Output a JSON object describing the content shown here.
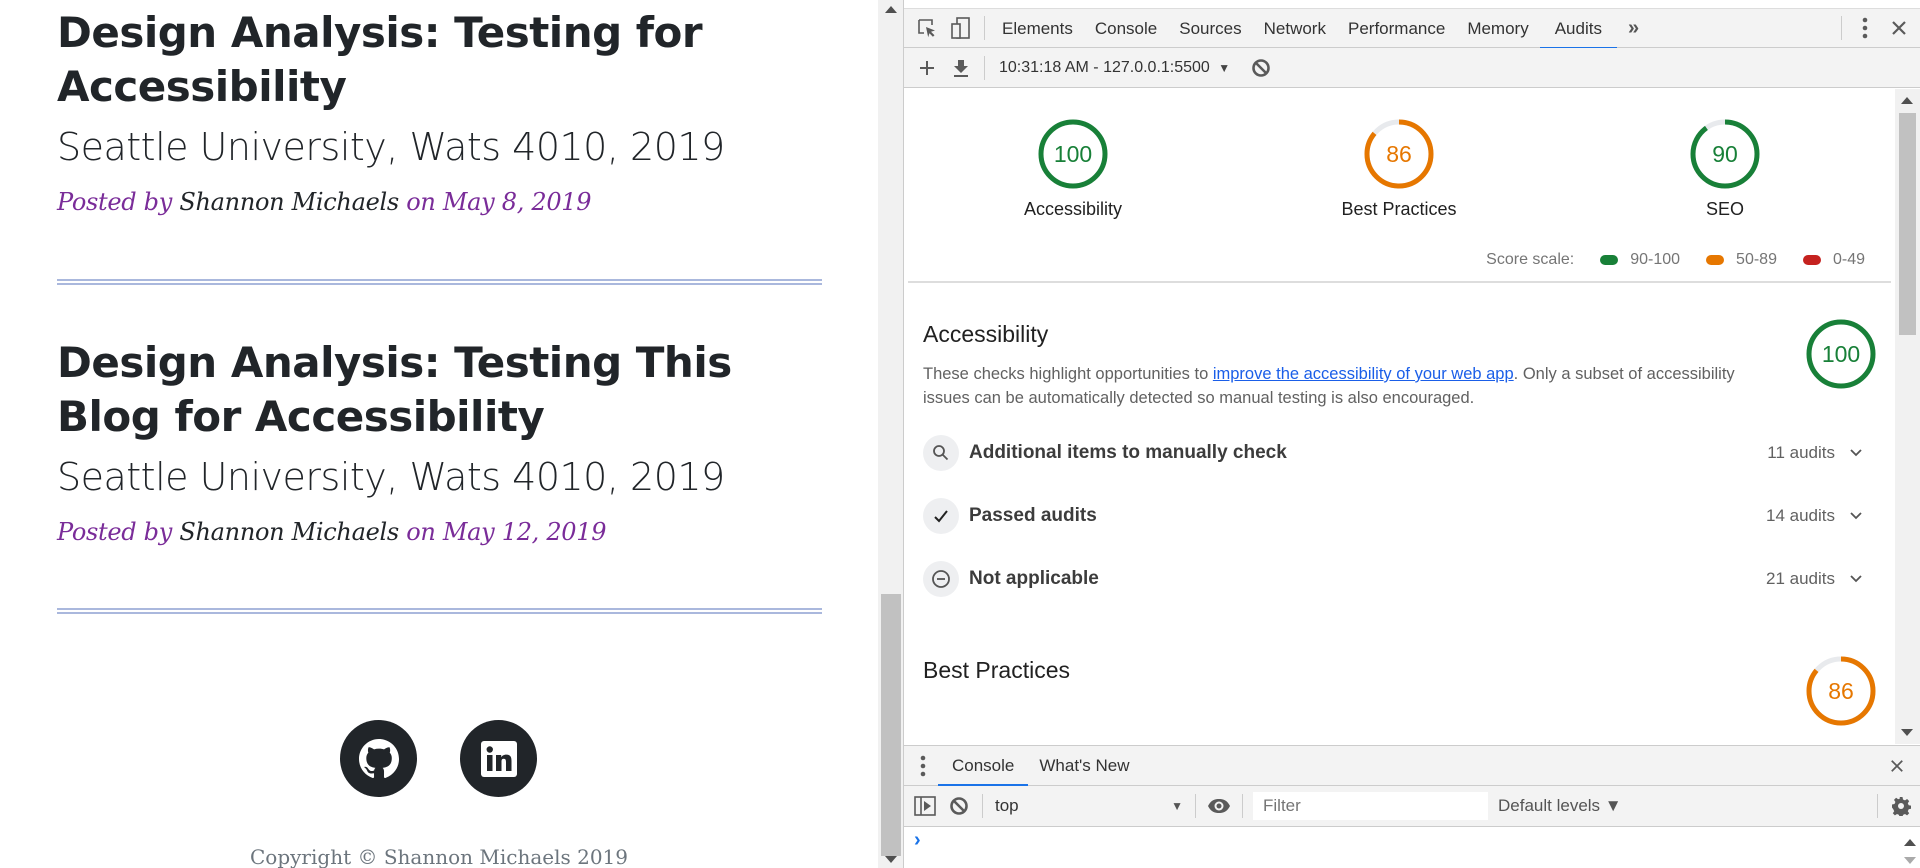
{
  "page": {
    "posts": [
      {
        "title": "Design Analysis: Testing for Accessibility",
        "subtitle": "Seattle University, Wats 4010, 2019",
        "posted_by_label": "Posted by",
        "author": "Shannon Michaels",
        "on_label": "on",
        "date": "May 8, 2019"
      },
      {
        "title": "Design Analysis: Testing This Blog for Accessibility",
        "subtitle": "Seattle University, Wats 4010, 2019",
        "posted_by_label": "Posted by",
        "author": "Shannon Michaels",
        "on_label": "on",
        "date": "May 12, 2019"
      }
    ],
    "social": [
      {
        "name": "github-icon"
      },
      {
        "name": "linkedin-icon"
      }
    ],
    "copyright": "Copyright © Shannon Michaels 2019"
  },
  "devtools": {
    "tabs": [
      "Elements",
      "Console",
      "Sources",
      "Network",
      "Performance",
      "Memory",
      "Audits"
    ],
    "active_tab": "Audits",
    "more_tabs_glyph": "»",
    "report_selector": "10:31:18 AM - 127.0.0.1:5500",
    "scores": [
      {
        "label": "Accessibility",
        "score": 100,
        "color": "#188038"
      },
      {
        "label": "Best Practices",
        "score": 86,
        "color": "#e67700"
      },
      {
        "label": "SEO",
        "score": 90,
        "color": "#188038"
      }
    ],
    "score_scale": {
      "label": "Score scale:",
      "ranges": [
        {
          "label": "90-100",
          "color": "#188038"
        },
        {
          "label": "50-89",
          "color": "#e67700"
        },
        {
          "label": "0-49",
          "color": "#c5221f"
        }
      ]
    },
    "accessibility": {
      "title": "Accessibility",
      "score": 100,
      "desc_before": "These checks highlight opportunities to ",
      "desc_link": "improve the accessibility of your web app",
      "desc_after": ". Only a subset of accessibility issues can be automatically detected so manual testing is also encouraged.",
      "groups": [
        {
          "icon": "search-icon",
          "title": "Additional items to manually check",
          "count": "11 audits"
        },
        {
          "icon": "check-icon",
          "title": "Passed audits",
          "count": "14 audits"
        },
        {
          "icon": "minus-circle-icon",
          "title": "Not applicable",
          "count": "21 audits"
        }
      ]
    },
    "best_practices": {
      "title": "Best Practices",
      "score": 86
    },
    "drawer": {
      "tabs": [
        "Console",
        "What's New"
      ],
      "active_tab": "Console",
      "context": "top",
      "filter_placeholder": "Filter",
      "levels": "Default levels ▼",
      "prompt": "›"
    }
  }
}
